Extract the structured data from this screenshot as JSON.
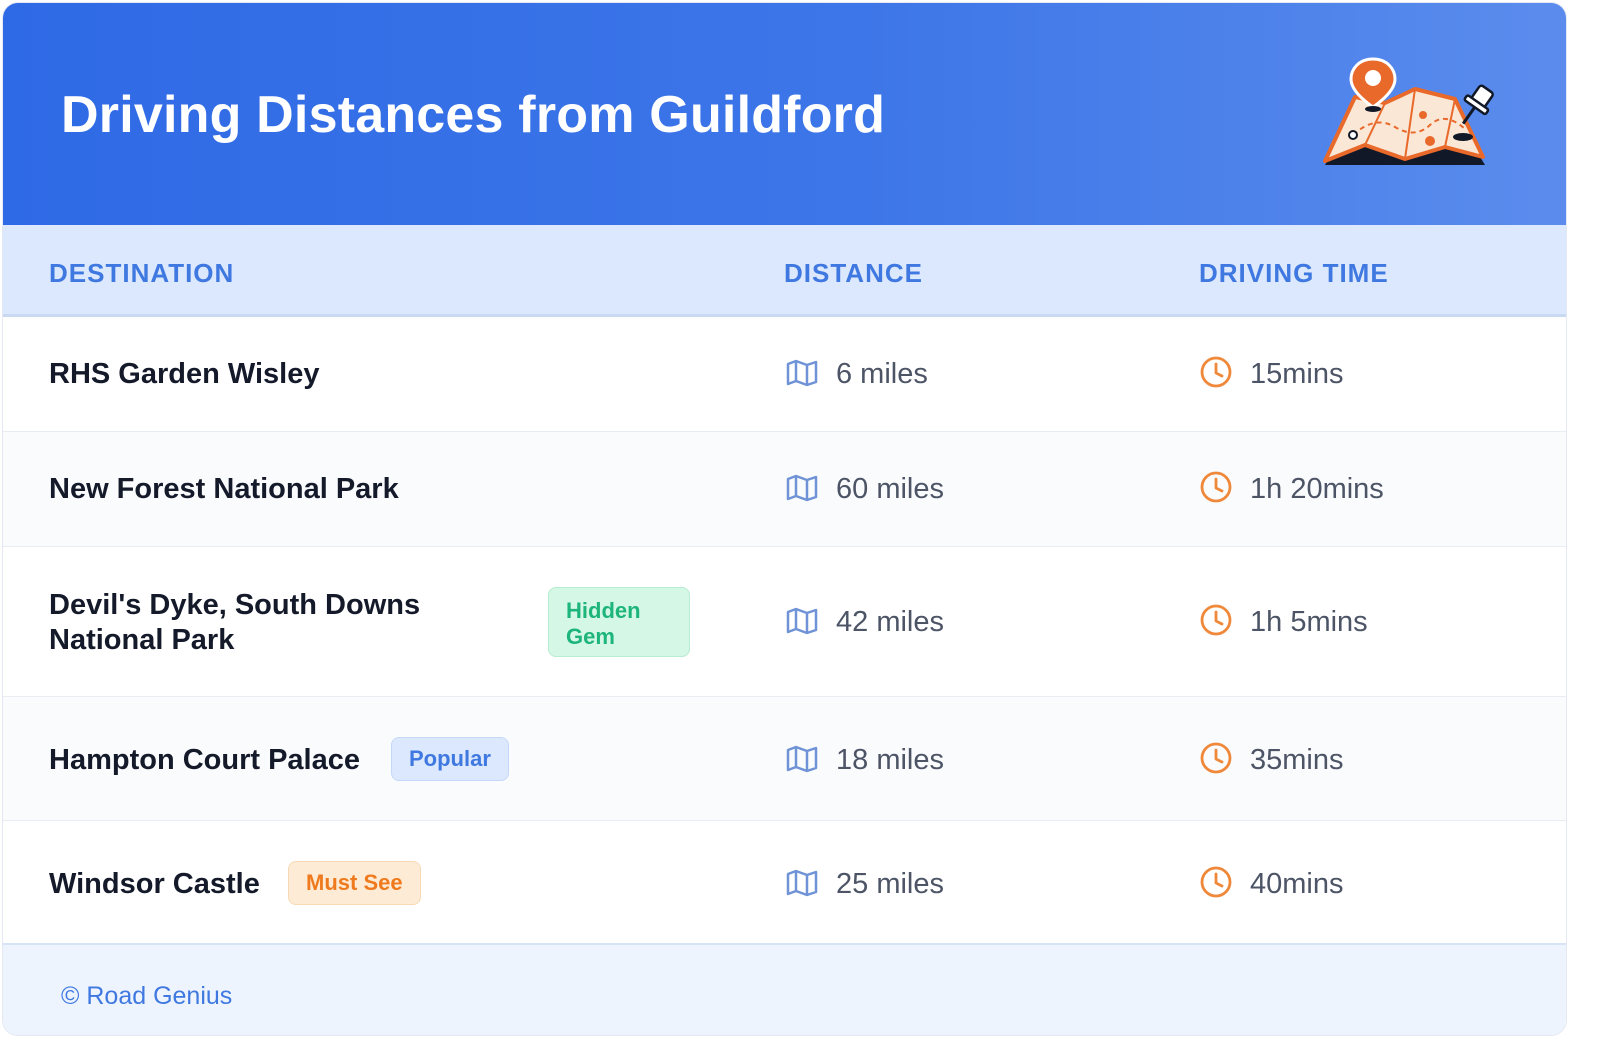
{
  "title": "Driving Distances from Guildford",
  "header_icon": "map-with-pins-illustration",
  "columns": {
    "destination": "DESTINATION",
    "distance": "DISTANCE",
    "driving_time": "DRIVING TIME"
  },
  "rows": [
    {
      "destination": "RHS Garden Wisley",
      "badge": "",
      "distance": "6 miles",
      "time": "15mins"
    },
    {
      "destination": "New Forest National Park",
      "badge": "",
      "distance": "60 miles",
      "time": "1h 20mins"
    },
    {
      "destination_line1": "Devil's Dyke, South Downs",
      "destination_line2": "National Park",
      "badge_line1": "Hidden",
      "badge_line2": "Gem",
      "distance": "42 miles",
      "time": "1h 5mins"
    },
    {
      "destination": "Hampton Court Palace",
      "badge": "Popular",
      "distance": "18 miles",
      "time": "35mins"
    },
    {
      "destination": "Windsor Castle",
      "badge": "Must See",
      "distance": "25 miles",
      "time": "40mins"
    }
  ],
  "icons": {
    "distance": "map-icon",
    "time": "clock-icon"
  },
  "colors": {
    "header_gradient_start": "#2f6ae6",
    "header_gradient_end": "#5b8ced",
    "accent_blue": "#3f78e0",
    "clock_orange": "#f0883a",
    "badge_green": "#1eb57a",
    "badge_orange": "#ef7a1e"
  },
  "footer": "© Road Genius"
}
